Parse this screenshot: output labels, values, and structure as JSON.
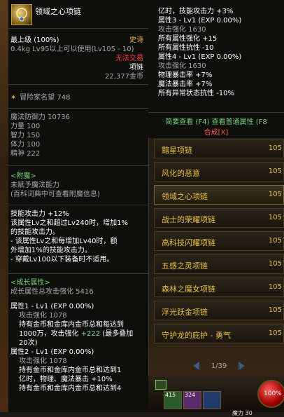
{
  "item": {
    "name": "领域之心项链",
    "grade_label": "最上级",
    "grade_pct": "(100%)",
    "rarity": "史诗",
    "weight": "0.4kg",
    "level_req": "Lv95以上可以使用(Lv105 - 10)",
    "trade": "无法交易",
    "type": "项链",
    "price": "22,377金币",
    "fame": "冒险家名望 748"
  },
  "stats": [
    "魔法防御力 10736",
    "力量 100",
    "智力 150",
    "体力 100",
    "精神 222"
  ],
  "enchant": {
    "title": "<附魔>",
    "line1": "未赋予魔法能力",
    "line2": "(百科词典中可查看附魔信息)"
  },
  "skill": [
    "技能攻击力 +12%",
    "该属性Lv之和超过Lv240时，增加1%",
    "的技能攻击力。",
    "- 该属性Lv之和每增加Lv40时，额",
    "外增加1%的技能攻击力。",
    "- 穿戴Lv100以下装备时不适用。"
  ],
  "growth": {
    "title": "<成长属性>",
    "total": "成长属性总攻击强化 5416",
    "attr1_title": "属性1 - Lv1 (EXP 0.00%)",
    "attr1_atk": "攻击强化 1078",
    "attr1_l1": "持有金币和金库内金币总和每达到",
    "attr1_l2": "1000万，攻击强化 ",
    "attr1_val": "+222",
    "attr1_l2b": "(最多叠加",
    "attr1_l3": "20次)",
    "attr2_title": "属性2 - Lv1 (EXP 0.00%)",
    "attr2_atk": "攻击强化 1078",
    "attr2_l1": "持有金币和金库内金币总和达到1",
    "attr2_l2": "亿时，物理、魔法暴击 +10%",
    "attr2_l3": "持有金币和金库内金币总和达到4"
  },
  "right_tooltip": [
    {
      "text": "亿时，技能攻击力 +3%",
      "cls": "c-white",
      "ind": ""
    },
    {
      "text": "属性3 - Lv1 (EXP 0.00%)",
      "cls": "c-white",
      "ind": ""
    },
    {
      "text": "攻击强化 1630",
      "cls": "c-gray",
      "ind": "indent"
    },
    {
      "text": "所有属性强化 +15",
      "cls": "c-white",
      "ind": "indent"
    },
    {
      "text": "所有属性抗性 -10",
      "cls": "c-white",
      "ind": "indent"
    },
    {
      "text": "属性4 - Lv1 (EXP 0.00%)",
      "cls": "c-white",
      "ind": ""
    },
    {
      "text": "攻击强化 1630",
      "cls": "c-gray",
      "ind": "indent"
    },
    {
      "text": "物理暴击率 +7%",
      "cls": "c-white",
      "ind": "indent"
    },
    {
      "text": "魔法暴击率 +7%",
      "cls": "c-white",
      "ind": "indent"
    },
    {
      "text": "所有异常状态抗性 -10%",
      "cls": "c-white",
      "ind": "indent"
    }
  ],
  "compare": {
    "line1": "简要查看 (F4) 查看普通属性 (F8",
    "line2": "合成[X]"
  },
  "list": [
    {
      "name": "黯星项链",
      "lv": "105",
      "sel": false
    },
    {
      "name": "风化的恶意",
      "lv": "105",
      "sel": false
    },
    {
      "name": "领域之心项链",
      "lv": "105",
      "sel": true
    },
    {
      "name": "战士的荣耀项链",
      "lv": "105",
      "sel": false
    },
    {
      "name": "高科技闪耀项链",
      "lv": "105",
      "sel": false
    },
    {
      "name": "五感之灵项链",
      "lv": "105",
      "sel": false
    },
    {
      "name": "森林之魔女项链",
      "lv": "105",
      "sel": false
    },
    {
      "name": "浮光跃金项链",
      "lv": "105",
      "sel": false
    },
    {
      "name": "守护龙的庇护 - 勇气",
      "lv": "105",
      "sel": false
    }
  ],
  "pager": {
    "text": "1/39"
  },
  "hotbar": {
    "slot1": "415",
    "slot2": "324",
    "orb": "100%",
    "bottom": "魔力 30"
  }
}
